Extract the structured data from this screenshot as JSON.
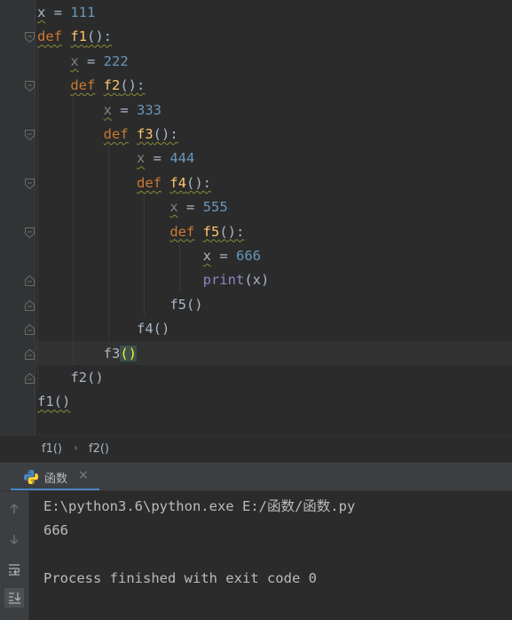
{
  "editor": {
    "lines": [
      {
        "tokens": [
          {
            "t": "x",
            "c": "wavy"
          },
          {
            "t": " = "
          },
          {
            "t": "111",
            "c": "num"
          }
        ]
      },
      {
        "tokens": [
          {
            "t": "def",
            "c": "kw wavy"
          },
          {
            "t": " "
          },
          {
            "t": "f1",
            "c": "fn wavy"
          },
          {
            "t": "():",
            "c": "wavy"
          }
        ]
      },
      {
        "tokens": [
          {
            "t": "    "
          },
          {
            "t": "x",
            "c": "dim wavy"
          },
          {
            "t": " = "
          },
          {
            "t": "222",
            "c": "num"
          }
        ]
      },
      {
        "tokens": [
          {
            "t": "    "
          },
          {
            "t": "def",
            "c": "kw wavy"
          },
          {
            "t": " "
          },
          {
            "t": "f2",
            "c": "fn wavy"
          },
          {
            "t": "():",
            "c": "wavy"
          }
        ]
      },
      {
        "tokens": [
          {
            "t": "        "
          },
          {
            "t": "x",
            "c": "dim wavy"
          },
          {
            "t": " = "
          },
          {
            "t": "333",
            "c": "num"
          }
        ]
      },
      {
        "tokens": [
          {
            "t": "        "
          },
          {
            "t": "def",
            "c": "kw wavy"
          },
          {
            "t": " "
          },
          {
            "t": "f3",
            "c": "fn wavy"
          },
          {
            "t": "():",
            "c": "wavy"
          }
        ]
      },
      {
        "tokens": [
          {
            "t": "            "
          },
          {
            "t": "x",
            "c": "dim wavy"
          },
          {
            "t": " = "
          },
          {
            "t": "444",
            "c": "num"
          }
        ]
      },
      {
        "tokens": [
          {
            "t": "            "
          },
          {
            "t": "def",
            "c": "kw wavy"
          },
          {
            "t": " "
          },
          {
            "t": "f4",
            "c": "fn wavy"
          },
          {
            "t": "():",
            "c": "wavy"
          }
        ]
      },
      {
        "tokens": [
          {
            "t": "                "
          },
          {
            "t": "x",
            "c": "dim wavy"
          },
          {
            "t": " = "
          },
          {
            "t": "555",
            "c": "num"
          }
        ]
      },
      {
        "tokens": [
          {
            "t": "                "
          },
          {
            "t": "def",
            "c": "kw wavy"
          },
          {
            "t": " "
          },
          {
            "t": "f5",
            "c": "fn wavy"
          },
          {
            "t": "():",
            "c": "wavy"
          }
        ]
      },
      {
        "tokens": [
          {
            "t": "                    "
          },
          {
            "t": "x",
            "c": "wavy"
          },
          {
            "t": " = "
          },
          {
            "t": "666",
            "c": "num"
          }
        ]
      },
      {
        "tokens": [
          {
            "t": "                    "
          },
          {
            "t": "print",
            "c": "bi"
          },
          {
            "t": "(x)"
          }
        ]
      },
      {
        "tokens": [
          {
            "t": "                "
          },
          {
            "t": "f5()"
          }
        ]
      },
      {
        "tokens": [
          {
            "t": "            "
          },
          {
            "t": "f4()"
          }
        ]
      },
      {
        "tokens": [
          {
            "t": "        "
          },
          {
            "t": "f3"
          },
          {
            "t": "()",
            "c": "brace-hl"
          }
        ]
      },
      {
        "tokens": [
          {
            "t": "    "
          },
          {
            "t": "f2()"
          }
        ]
      },
      {
        "tokens": [
          {
            "t": "f1()",
            "c": "wavy"
          }
        ]
      }
    ]
  },
  "breadcrumbs": [
    "f1()",
    "f2()"
  ],
  "run": {
    "tab_label": "函数",
    "close_glyph": "×",
    "console": [
      "E:\\python3.6\\python.exe E:/函数/函数.py",
      "666",
      "",
      "Process finished with exit code 0"
    ]
  },
  "icons": {
    "fold": "fold-marker-icon",
    "python": "python-icon",
    "up": "arrow-up-icon",
    "down": "arrow-down-icon",
    "wrap": "soft-wrap-icon",
    "scroll_end": "scroll-to-end-icon"
  },
  "colors": {
    "background": "#2b2b2b",
    "keyword": "#cc7832",
    "function": "#ffc66d",
    "number": "#6897bb",
    "builtin": "#8888c6",
    "text": "#a9b7c6",
    "accent": "#4a88c7"
  }
}
